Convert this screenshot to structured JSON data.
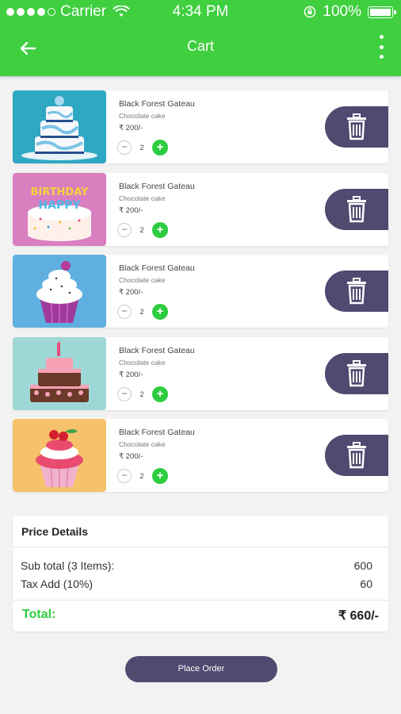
{
  "status_bar": {
    "carrier": "Carrier",
    "time": "4:34 PM",
    "battery": "100%"
  },
  "app_bar": {
    "title": "Cart",
    "back_icon": "back-arrow-icon",
    "menu_icon": "more-vertical-icon"
  },
  "cart": {
    "items": [
      {
        "name": "Black Forest Gateau",
        "desc": "Chocolate cake",
        "price": "₹ 200/-",
        "qty": "2",
        "image": "wedding-cake"
      },
      {
        "name": "Black Forest Gateau",
        "desc": "Chocolate cake",
        "price": "₹ 200/-",
        "qty": "2",
        "image": "birthday-cake"
      },
      {
        "name": "Black Forest Gateau",
        "desc": "Chocolate cake",
        "price": "₹ 200/-",
        "qty": "2",
        "image": "cupcake"
      },
      {
        "name": "Black Forest Gateau",
        "desc": "Chocolate cake",
        "price": "₹ 200/-",
        "qty": "2",
        "image": "first-birthday-cake"
      },
      {
        "name": "Black Forest Gateau",
        "desc": "Chocolate cake",
        "price": "₹ 200/-",
        "qty": "2",
        "image": "cherry-cupcake"
      }
    ],
    "minus_symbol": "−",
    "plus_symbol": "+"
  },
  "price_details": {
    "title": "Price Details",
    "subtotal_label": "Sub total (3 Items):",
    "subtotal_value": "600",
    "tax_label": "Tax Add (10%)",
    "tax_value": "60",
    "total_label": "Total:",
    "total_value": "₹ 660/-"
  },
  "place_order_label": "Place Order",
  "colors": {
    "primary_green": "#3fcf3f",
    "accent_purple": "#4e4a70"
  }
}
